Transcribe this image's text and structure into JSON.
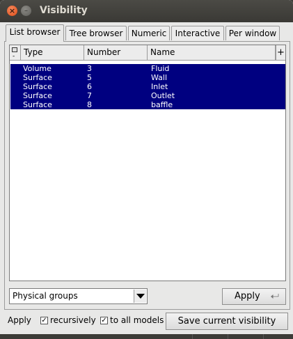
{
  "window": {
    "title": "Visibility",
    "close_glyph": "×",
    "minimize_glyph": "–"
  },
  "tabs": [
    {
      "label": "List browser",
      "active": true
    },
    {
      "label": "Tree browser",
      "active": false
    },
    {
      "label": "Numeric",
      "active": false
    },
    {
      "label": "Interactive",
      "active": false
    },
    {
      "label": "Per window",
      "active": false
    }
  ],
  "list": {
    "columns": {
      "type": "Type",
      "number": "Number",
      "name": "Name"
    },
    "add_column_glyph": "+",
    "toggle_glyph": "-",
    "selected_color": "#000080",
    "rows": [
      {
        "type": "Volume",
        "number": "3",
        "name": "Fluid"
      },
      {
        "type": "Surface",
        "number": "5",
        "name": "Wall"
      },
      {
        "type": "Surface",
        "number": "6",
        "name": "Inlet"
      },
      {
        "type": "Surface",
        "number": "7",
        "name": "Outlet"
      },
      {
        "type": "Surface",
        "number": "8",
        "name": "baffle"
      }
    ]
  },
  "mode_select": {
    "value": "Physical groups",
    "icon": "chevron-down-icon"
  },
  "apply_button": {
    "label": "Apply",
    "icon": "enter-key-icon"
  },
  "footer": {
    "apply_label": "Apply",
    "recursively": {
      "label": "recursively",
      "checked": true
    },
    "to_all_models": {
      "label": "to all models",
      "checked": true
    },
    "check_glyph": "✓",
    "save_button_label": "Save current visibility"
  }
}
